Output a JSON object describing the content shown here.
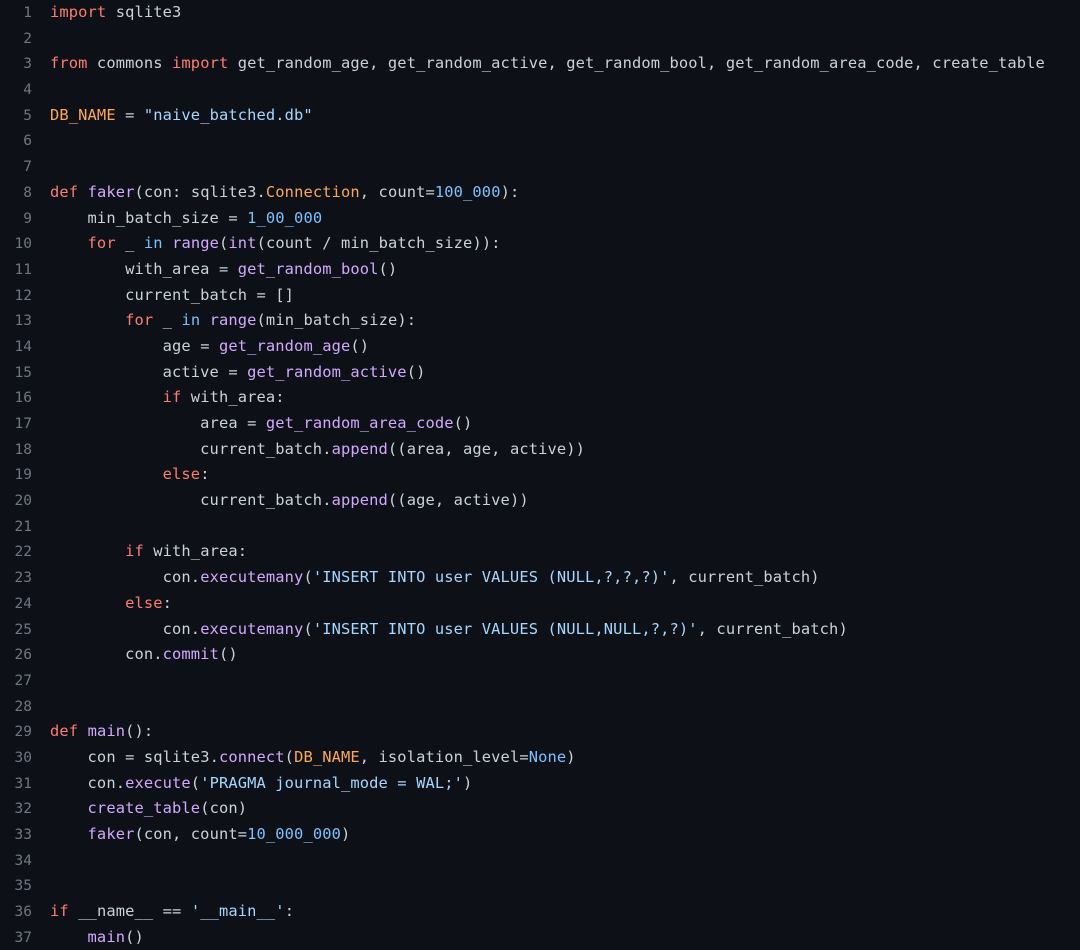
{
  "editor": {
    "language": "python",
    "filename": "naive_batched.py",
    "total_lines": 37,
    "theme": "dark",
    "colors": {
      "background": "#0d1117",
      "plain_text": "#c9d1d9",
      "line_number": "#6e7681",
      "keyword": "#ff7b72",
      "function": "#d2a8ff",
      "number": "#79c0ff",
      "string": "#a5d6ff",
      "class_constant": "#ffa657"
    }
  },
  "lines": [
    {
      "n": "1",
      "tokens": [
        {
          "t": "import",
          "c": "t-kw"
        },
        {
          "t": " sqlite3",
          "c": "t-pl"
        }
      ]
    },
    {
      "n": "2",
      "tokens": []
    },
    {
      "n": "3",
      "tokens": [
        {
          "t": "from",
          "c": "t-kw"
        },
        {
          "t": " commons ",
          "c": "t-pl"
        },
        {
          "t": "import",
          "c": "t-kw"
        },
        {
          "t": " get_random_age, get_random_active, get_random_bool, get_random_area_code, create_table",
          "c": "t-pl"
        }
      ]
    },
    {
      "n": "4",
      "tokens": []
    },
    {
      "n": "5",
      "tokens": [
        {
          "t": "DB_NAME",
          "c": "t-cls"
        },
        {
          "t": " = ",
          "c": "t-op"
        },
        {
          "t": "\"naive_batched.db\"",
          "c": "t-str"
        }
      ]
    },
    {
      "n": "6",
      "tokens": []
    },
    {
      "n": "7",
      "tokens": []
    },
    {
      "n": "8",
      "tokens": [
        {
          "t": "def",
          "c": "t-kw"
        },
        {
          "t": " ",
          "c": "t-pl"
        },
        {
          "t": "faker",
          "c": "t-fn"
        },
        {
          "t": "(con: sqlite3.",
          "c": "t-pl"
        },
        {
          "t": "Connection",
          "c": "t-cls"
        },
        {
          "t": ", count=",
          "c": "t-pl"
        },
        {
          "t": "100_000",
          "c": "t-num"
        },
        {
          "t": "):",
          "c": "t-pl"
        }
      ]
    },
    {
      "n": "9",
      "tokens": [
        {
          "t": "    min_batch_size ",
          "c": "t-pl"
        },
        {
          "t": "= ",
          "c": "t-op"
        },
        {
          "t": "1_00_000",
          "c": "t-num"
        }
      ]
    },
    {
      "n": "10",
      "tokens": [
        {
          "t": "    ",
          "c": "t-pl"
        },
        {
          "t": "for",
          "c": "t-kw"
        },
        {
          "t": " _ ",
          "c": "t-pl"
        },
        {
          "t": "in",
          "c": "t-num"
        },
        {
          "t": " ",
          "c": "t-pl"
        },
        {
          "t": "range",
          "c": "t-fn"
        },
        {
          "t": "(",
          "c": "t-pl"
        },
        {
          "t": "int",
          "c": "t-fn"
        },
        {
          "t": "(count / min_batch_size)):",
          "c": "t-pl"
        }
      ]
    },
    {
      "n": "11",
      "tokens": [
        {
          "t": "        with_area ",
          "c": "t-pl"
        },
        {
          "t": "= ",
          "c": "t-op"
        },
        {
          "t": "get_random_bool",
          "c": "t-fn"
        },
        {
          "t": "()",
          "c": "t-pl"
        }
      ]
    },
    {
      "n": "12",
      "tokens": [
        {
          "t": "        current_batch ",
          "c": "t-pl"
        },
        {
          "t": "= ",
          "c": "t-op"
        },
        {
          "t": "[]",
          "c": "t-pl"
        }
      ]
    },
    {
      "n": "13",
      "tokens": [
        {
          "t": "        ",
          "c": "t-pl"
        },
        {
          "t": "for",
          "c": "t-kw"
        },
        {
          "t": " _ ",
          "c": "t-pl"
        },
        {
          "t": "in",
          "c": "t-num"
        },
        {
          "t": " ",
          "c": "t-pl"
        },
        {
          "t": "range",
          "c": "t-fn"
        },
        {
          "t": "(min_batch_size):",
          "c": "t-pl"
        }
      ]
    },
    {
      "n": "14",
      "tokens": [
        {
          "t": "            age ",
          "c": "t-pl"
        },
        {
          "t": "= ",
          "c": "t-op"
        },
        {
          "t": "get_random_age",
          "c": "t-fn"
        },
        {
          "t": "()",
          "c": "t-pl"
        }
      ]
    },
    {
      "n": "15",
      "tokens": [
        {
          "t": "            active ",
          "c": "t-pl"
        },
        {
          "t": "= ",
          "c": "t-op"
        },
        {
          "t": "get_random_active",
          "c": "t-fn"
        },
        {
          "t": "()",
          "c": "t-pl"
        }
      ]
    },
    {
      "n": "16",
      "tokens": [
        {
          "t": "            ",
          "c": "t-pl"
        },
        {
          "t": "if",
          "c": "t-kw"
        },
        {
          "t": " with_area:",
          "c": "t-pl"
        }
      ]
    },
    {
      "n": "17",
      "tokens": [
        {
          "t": "                area ",
          "c": "t-pl"
        },
        {
          "t": "= ",
          "c": "t-op"
        },
        {
          "t": "get_random_area_code",
          "c": "t-fn"
        },
        {
          "t": "()",
          "c": "t-pl"
        }
      ]
    },
    {
      "n": "18",
      "tokens": [
        {
          "t": "                current_batch.",
          "c": "t-pl"
        },
        {
          "t": "append",
          "c": "t-fn"
        },
        {
          "t": "((area, age, active))",
          "c": "t-pl"
        }
      ]
    },
    {
      "n": "19",
      "tokens": [
        {
          "t": "            ",
          "c": "t-pl"
        },
        {
          "t": "else",
          "c": "t-kw"
        },
        {
          "t": ":",
          "c": "t-pl"
        }
      ]
    },
    {
      "n": "20",
      "tokens": [
        {
          "t": "                current_batch.",
          "c": "t-pl"
        },
        {
          "t": "append",
          "c": "t-fn"
        },
        {
          "t": "((age, active))",
          "c": "t-pl"
        }
      ]
    },
    {
      "n": "21",
      "tokens": []
    },
    {
      "n": "22",
      "tokens": [
        {
          "t": "        ",
          "c": "t-pl"
        },
        {
          "t": "if",
          "c": "t-kw"
        },
        {
          "t": " with_area:",
          "c": "t-pl"
        }
      ]
    },
    {
      "n": "23",
      "tokens": [
        {
          "t": "            con.",
          "c": "t-pl"
        },
        {
          "t": "executemany",
          "c": "t-fn"
        },
        {
          "t": "(",
          "c": "t-pl"
        },
        {
          "t": "'INSERT INTO user VALUES (NULL,?,?,?)'",
          "c": "t-str"
        },
        {
          "t": ", current_batch)",
          "c": "t-pl"
        }
      ]
    },
    {
      "n": "24",
      "tokens": [
        {
          "t": "        ",
          "c": "t-pl"
        },
        {
          "t": "else",
          "c": "t-kw"
        },
        {
          "t": ":",
          "c": "t-pl"
        }
      ]
    },
    {
      "n": "25",
      "tokens": [
        {
          "t": "            con.",
          "c": "t-pl"
        },
        {
          "t": "executemany",
          "c": "t-fn"
        },
        {
          "t": "(",
          "c": "t-pl"
        },
        {
          "t": "'INSERT INTO user VALUES (NULL,NULL,?,?)'",
          "c": "t-str"
        },
        {
          "t": ", current_batch)",
          "c": "t-pl"
        }
      ]
    },
    {
      "n": "26",
      "tokens": [
        {
          "t": "        con.",
          "c": "t-pl"
        },
        {
          "t": "commit",
          "c": "t-fn"
        },
        {
          "t": "()",
          "c": "t-pl"
        }
      ]
    },
    {
      "n": "27",
      "tokens": []
    },
    {
      "n": "28",
      "tokens": []
    },
    {
      "n": "29",
      "tokens": [
        {
          "t": "def",
          "c": "t-kw"
        },
        {
          "t": " ",
          "c": "t-pl"
        },
        {
          "t": "main",
          "c": "t-fn"
        },
        {
          "t": "():",
          "c": "t-pl"
        }
      ]
    },
    {
      "n": "30",
      "tokens": [
        {
          "t": "    con ",
          "c": "t-pl"
        },
        {
          "t": "= ",
          "c": "t-op"
        },
        {
          "t": "sqlite3.",
          "c": "t-pl"
        },
        {
          "t": "connect",
          "c": "t-fn"
        },
        {
          "t": "(",
          "c": "t-pl"
        },
        {
          "t": "DB_NAME",
          "c": "t-cls"
        },
        {
          "t": ", isolation_level=",
          "c": "t-pl"
        },
        {
          "t": "None",
          "c": "t-num"
        },
        {
          "t": ")",
          "c": "t-pl"
        }
      ]
    },
    {
      "n": "31",
      "tokens": [
        {
          "t": "    con.",
          "c": "t-pl"
        },
        {
          "t": "execute",
          "c": "t-fn"
        },
        {
          "t": "(",
          "c": "t-pl"
        },
        {
          "t": "'PRAGMA journal_mode = WAL;'",
          "c": "t-str"
        },
        {
          "t": ")",
          "c": "t-pl"
        }
      ]
    },
    {
      "n": "32",
      "tokens": [
        {
          "t": "    ",
          "c": "t-pl"
        },
        {
          "t": "create_table",
          "c": "t-fn"
        },
        {
          "t": "(con)",
          "c": "t-pl"
        }
      ]
    },
    {
      "n": "33",
      "tokens": [
        {
          "t": "    ",
          "c": "t-pl"
        },
        {
          "t": "faker",
          "c": "t-fn"
        },
        {
          "t": "(con, count=",
          "c": "t-pl"
        },
        {
          "t": "10_000_000",
          "c": "t-num"
        },
        {
          "t": ")",
          "c": "t-pl"
        }
      ]
    },
    {
      "n": "34",
      "tokens": []
    },
    {
      "n": "35",
      "tokens": []
    },
    {
      "n": "36",
      "tokens": [
        {
          "t": "if",
          "c": "t-kw"
        },
        {
          "t": " __name__ ",
          "c": "t-pl"
        },
        {
          "t": "== ",
          "c": "t-op"
        },
        {
          "t": "'__main__'",
          "c": "t-str"
        },
        {
          "t": ":",
          "c": "t-pl"
        }
      ]
    },
    {
      "n": "37",
      "tokens": [
        {
          "t": "    ",
          "c": "t-pl"
        },
        {
          "t": "main",
          "c": "t-fn"
        },
        {
          "t": "()",
          "c": "t-pl"
        }
      ]
    }
  ]
}
